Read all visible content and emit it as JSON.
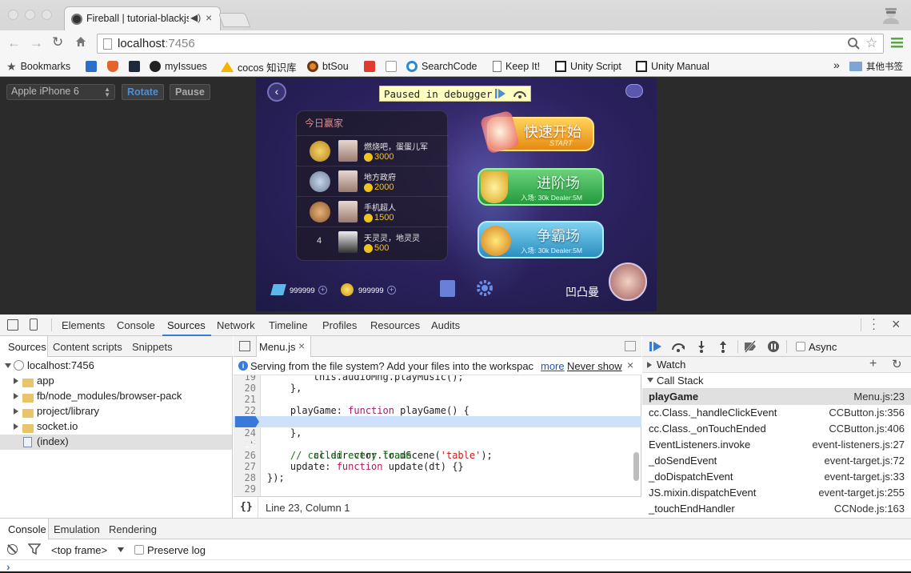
{
  "browser": {
    "tab_title": "Fireball | tutorial-blackjs",
    "url_host": "localhost",
    "url_port": ":7456",
    "bookmarks": [
      "Bookmarks",
      "myIssues",
      "cocos 知识库",
      "btSou",
      "SearchCode",
      "Keep It!",
      "Unity Script",
      "Unity Manual"
    ],
    "other_bookmarks": "其他书签",
    "overflow": "»"
  },
  "simulator": {
    "device": "Apple iPhone 6",
    "rotate_label": "Rotate",
    "pause_label": "Pause",
    "paused_text": "Paused in debugger"
  },
  "game": {
    "rank_title": "今日赢家",
    "rank_rows": [
      {
        "name": "燃烧吧，蛋蛋儿军",
        "coins": "3000"
      },
      {
        "name": "地方政府",
        "coins": "2000"
      },
      {
        "name": "手机超人",
        "coins": "1500"
      },
      {
        "rank": "4",
        "name": "天灵灵，地灵灵",
        "coins": "500"
      }
    ],
    "btn_quick": "快速开始",
    "btn_quick_sub": "START",
    "btn_advanced": "进阶场",
    "btn_advanced_sub": "入场: 30k  Dealer:5M",
    "btn_hegemony": "争霸场",
    "btn_hegemony_sub": "入场: 30k  Dealer:5M",
    "diamonds": "999999",
    "gold": "999999",
    "player_name": "凹凸曼"
  },
  "devtools": {
    "tabs": [
      "Elements",
      "Console",
      "Sources",
      "Network",
      "Timeline",
      "Profiles",
      "Resources",
      "Audits"
    ],
    "active_tab": "Sources",
    "nav_tabs": [
      "Sources",
      "Content scripts",
      "Snippets"
    ],
    "tree": {
      "root": "localhost:7456",
      "folders": [
        "app",
        "fb/node_modules/browser-pack",
        "project/library",
        "socket.io"
      ],
      "file": "(index)"
    },
    "open_file": "Menu.js",
    "info_message": "Serving from the file system? Add your files into the workspac",
    "info_more": "more",
    "info_never": "Never show",
    "code": [
      {
        "n": "19",
        "t": "        this.audioMng.playMusic();"
      },
      {
        "n": "20",
        "t": "    },"
      },
      {
        "n": "21",
        "t": ""
      },
      {
        "n": "22",
        "t": "    playGame: function playGame() {"
      },
      {
        "n": "23",
        "t": "        cc.director.loadScene('table');"
      },
      {
        "n": "24",
        "t": "    },"
      },
      {
        "n": "25",
        "t": ""
      },
      {
        "n": "26",
        "t": "    // called every frame"
      },
      {
        "n": "27",
        "t": "    update: function update(dt) {}"
      },
      {
        "n": "28",
        "t": "});"
      },
      {
        "n": "29",
        "t": ""
      }
    ],
    "current_line": "23",
    "status": "Line 23, Column 1",
    "pretty_print": "{}",
    "async_label": "Async",
    "watch_label": "Watch",
    "callstack_label": "Call Stack",
    "call_stack": [
      {
        "fn": "playGame",
        "loc": "Menu.js:23"
      },
      {
        "fn": "cc.Class._handleClickEvent",
        "loc": "CCButton.js:356"
      },
      {
        "fn": "cc.Class._onTouchEnded",
        "loc": "CCButton.js:406"
      },
      {
        "fn": "EventListeners.invoke",
        "loc": "event-listeners.js:27"
      },
      {
        "fn": "_doSendEvent",
        "loc": "event-target.js:72"
      },
      {
        "fn": "_doDispatchEvent",
        "loc": "event-target.js:33"
      },
      {
        "fn": "JS.mixin.dispatchEvent",
        "loc": "event-target.js:255"
      },
      {
        "fn": "_touchEndHandler",
        "loc": "CCNode.js:163"
      }
    ],
    "drawer_tabs": [
      "Console",
      "Emulation",
      "Rendering"
    ],
    "frame_select": "<top frame>",
    "preserve_log": "Preserve log",
    "prompt": "›"
  }
}
